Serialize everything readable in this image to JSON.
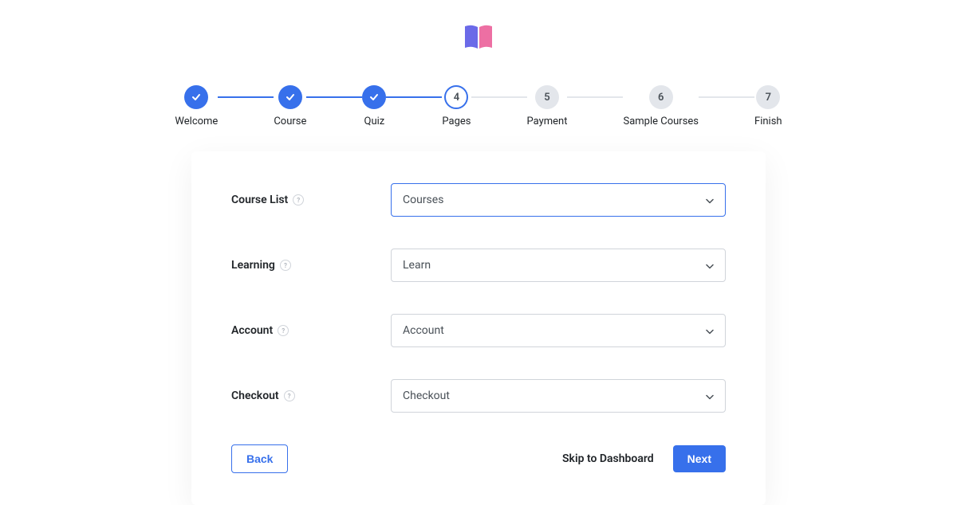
{
  "steps": [
    {
      "label": "Welcome",
      "state": "completed"
    },
    {
      "label": "Course",
      "state": "completed"
    },
    {
      "label": "Quiz",
      "state": "completed"
    },
    {
      "label": "Pages",
      "state": "active",
      "num": "4"
    },
    {
      "label": "Payment",
      "state": "pending",
      "num": "5"
    },
    {
      "label": "Sample Courses",
      "state": "pending",
      "num": "6"
    },
    {
      "label": "Finish",
      "state": "pending",
      "num": "7"
    }
  ],
  "form": {
    "rows": [
      {
        "label": "Course List",
        "value": "Courses",
        "focused": true
      },
      {
        "label": "Learning",
        "value": "Learn",
        "focused": false
      },
      {
        "label": "Account",
        "value": "Account",
        "focused": false
      },
      {
        "label": "Checkout",
        "value": "Checkout",
        "focused": false
      }
    ]
  },
  "footer": {
    "back": "Back",
    "skip": "Skip to Dashboard",
    "next": "Next"
  }
}
